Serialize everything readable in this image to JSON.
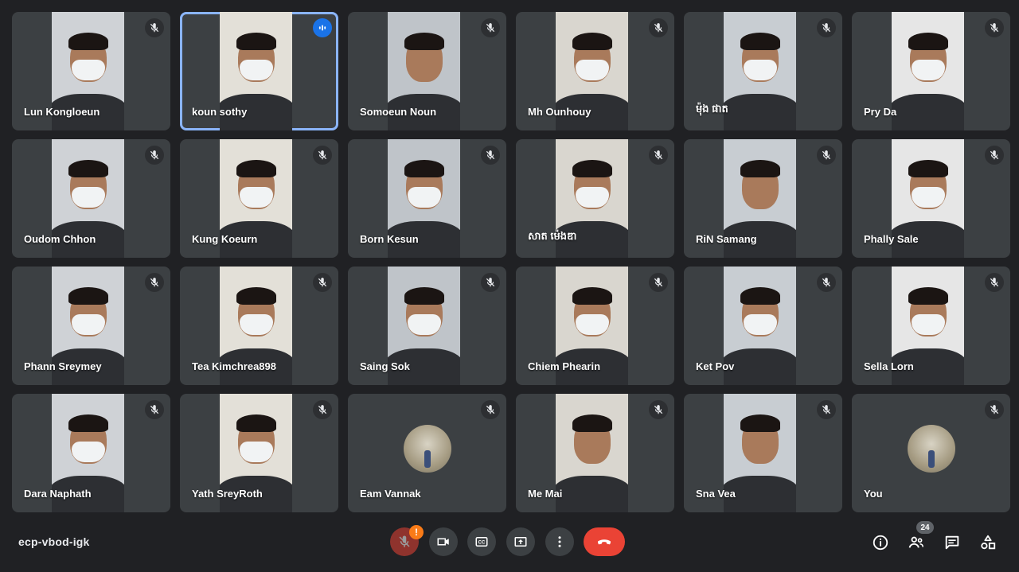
{
  "meeting": {
    "code": "ecp-vbod-igk",
    "participant_count": "24"
  },
  "participants": [
    {
      "name": "Lun Kongloeun",
      "mask": true,
      "speaking": false
    },
    {
      "name": "koun sothy",
      "mask": true,
      "speaking": true
    },
    {
      "name": "Somoeun Noun",
      "mask": false,
      "speaking": false
    },
    {
      "name": "Mh Ounhouy",
      "mask": true,
      "speaking": false
    },
    {
      "name": "ម៉ុង ផាត",
      "mask": true,
      "speaking": false
    },
    {
      "name": "Pry Da",
      "mask": true,
      "speaking": false
    },
    {
      "name": "Oudom Chhon",
      "mask": true,
      "speaking": false
    },
    {
      "name": "Kung Koeurn",
      "mask": true,
      "speaking": false
    },
    {
      "name": "Born Kesun",
      "mask": true,
      "speaking": false
    },
    {
      "name": "សាត ម៉េងឌា",
      "mask": true,
      "speaking": false
    },
    {
      "name": "RiN Samang",
      "mask": false,
      "speaking": false
    },
    {
      "name": "Phally Sale",
      "mask": true,
      "speaking": false
    },
    {
      "name": "Phann Sreymey",
      "mask": true,
      "speaking": false
    },
    {
      "name": "Tea Kimchrea898",
      "mask": true,
      "speaking": false
    },
    {
      "name": "Saing Sok",
      "mask": true,
      "speaking": false
    },
    {
      "name": "Chiem Phearin",
      "mask": true,
      "speaking": false
    },
    {
      "name": "Ket Pov",
      "mask": true,
      "speaking": false
    },
    {
      "name": "Sella Lorn",
      "mask": true,
      "speaking": false
    },
    {
      "name": "Dara Naphath",
      "mask": true,
      "speaking": false
    },
    {
      "name": "Yath SreyRoth",
      "mask": true,
      "speaking": false
    },
    {
      "name": "Eam Vannak",
      "avatar": true,
      "speaking": false
    },
    {
      "name": "Me Mai",
      "mask": false,
      "speaking": false
    },
    {
      "name": "Sna Vea",
      "mask": false,
      "speaking": false
    },
    {
      "name": "You",
      "avatar": true,
      "speaking": false
    }
  ],
  "controls": {
    "mic": "mic-off-icon",
    "camera": "videocam-icon",
    "captions": "closed-caption-icon",
    "present": "present-screen-icon",
    "more": "more-vert-icon",
    "end_call": "call-end-icon",
    "warning_badge": "!"
  },
  "right_controls": [
    "info-icon",
    "people-icon",
    "chat-icon",
    "activities-icon"
  ],
  "colors": {
    "background": "#202124",
    "tile": "#3c4043",
    "accent": "#1a73e8",
    "end_call": "#ea4335",
    "warning": "#fa7b17"
  }
}
